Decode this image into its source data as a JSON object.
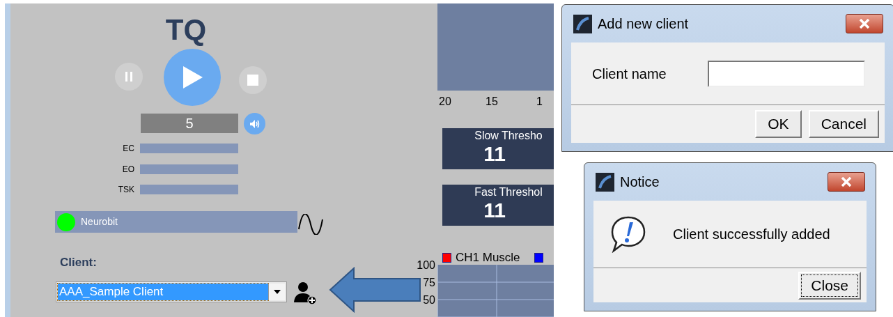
{
  "app": {
    "title": "TQ",
    "counter": "5",
    "bands": [
      {
        "label": "EC"
      },
      {
        "label": "EO"
      },
      {
        "label": "TSK"
      }
    ],
    "device": {
      "name": "Neurobit",
      "color": "#00ff00"
    },
    "client_label": "Client:",
    "client_select": {
      "value": "AAA_Sample Client",
      "selected": true
    },
    "histogram_axis": [
      "20",
      "15",
      "1"
    ],
    "thresholds": [
      {
        "label": "Slow Thresho",
        "value": "11"
      },
      {
        "label": "Fast Threshol",
        "value": "11"
      }
    ],
    "legend": [
      {
        "label": "CH1 Muscle",
        "color": "#ff0000"
      },
      {
        "color": "#0000ff"
      }
    ],
    "chart_ticks": [
      "100",
      "75",
      "50"
    ]
  },
  "dialogs": [
    {
      "kind": "form",
      "title": "Add new client",
      "field_label": "Client name",
      "buttons": [
        {
          "label": "OK",
          "focused": false
        },
        {
          "label": "Cancel",
          "focused": false
        }
      ]
    },
    {
      "kind": "notice",
      "title": "Notice",
      "message": "Client successfully added",
      "buttons": [
        {
          "label": "Close",
          "focused": true
        }
      ]
    }
  ]
}
